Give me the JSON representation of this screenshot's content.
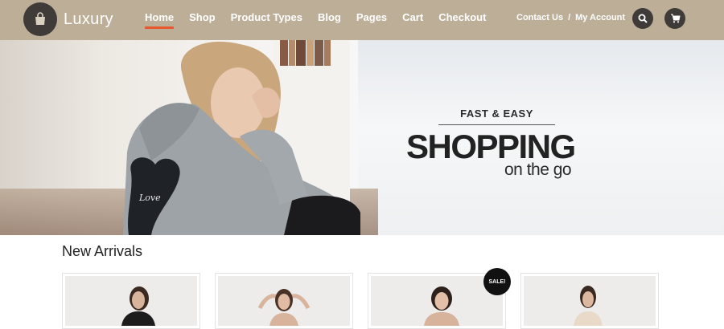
{
  "brand": {
    "name": "Luxury",
    "logo_icon": "shopping-bag-icon"
  },
  "nav": {
    "items": [
      {
        "label": "Home",
        "active": true
      },
      {
        "label": "Shop",
        "active": false
      },
      {
        "label": "Product Types",
        "active": false
      },
      {
        "label": "Blog",
        "active": false
      },
      {
        "label": "Pages",
        "active": false
      },
      {
        "label": "Cart",
        "active": false
      },
      {
        "label": "Checkout",
        "active": false
      }
    ]
  },
  "account": {
    "contact": "Contact Us",
    "separator": "/",
    "my_account": "My Account"
  },
  "header_buttons": {
    "search_icon": "search-icon",
    "cart_icon": "cart-icon"
  },
  "hero": {
    "eyebrow": "FAST & EASY",
    "title": "SHOPPING",
    "subtitle": "on the go"
  },
  "new_arrivals": {
    "title": "New Arrivals",
    "sale_badge": "SALE!",
    "products": [
      {
        "has_sale": false
      },
      {
        "has_sale": false
      },
      {
        "has_sale": true
      },
      {
        "has_sale": false
      }
    ]
  },
  "colors": {
    "header_bg": "#bcae97",
    "accent": "#e8582c",
    "dark": "#3f3b38"
  }
}
